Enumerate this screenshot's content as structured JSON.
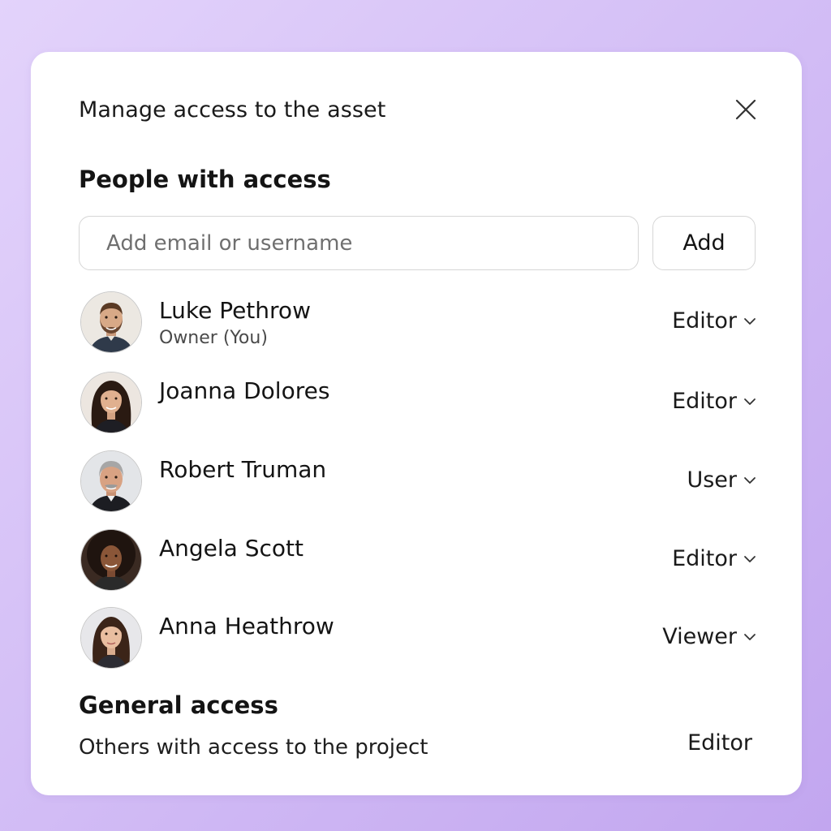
{
  "dialog": {
    "title": "Manage access to the asset",
    "close_icon": "close-icon"
  },
  "people_section": {
    "heading": "People with access",
    "input_placeholder": "Add email or username",
    "input_value": "",
    "add_label": "Add"
  },
  "people": [
    {
      "name": "Luke Pethrow",
      "subtitle": "Owner (You)",
      "role": "Editor",
      "avatar_icon": "avatar-man-beard"
    },
    {
      "name": "Joanna Dolores",
      "subtitle": "",
      "role": "Editor",
      "avatar_icon": "avatar-woman-dark-hair"
    },
    {
      "name": "Robert Truman",
      "subtitle": "",
      "role": "User",
      "avatar_icon": "avatar-man-gray-hair"
    },
    {
      "name": "Angela Scott",
      "subtitle": "",
      "role": "Editor",
      "avatar_icon": "avatar-woman-curly-hair"
    },
    {
      "name": "Anna Heathrow",
      "subtitle": "",
      "role": "Viewer",
      "avatar_icon": "avatar-woman-long-hair"
    }
  ],
  "general_section": {
    "heading": "General access",
    "description": "Others with access to the project",
    "role": "Editor"
  },
  "colors": {
    "background_start": "#e3d3fb",
    "background_end": "#c2a6ef",
    "card": "#ffffff",
    "text": "#141414",
    "border": "#d6d6d6"
  }
}
